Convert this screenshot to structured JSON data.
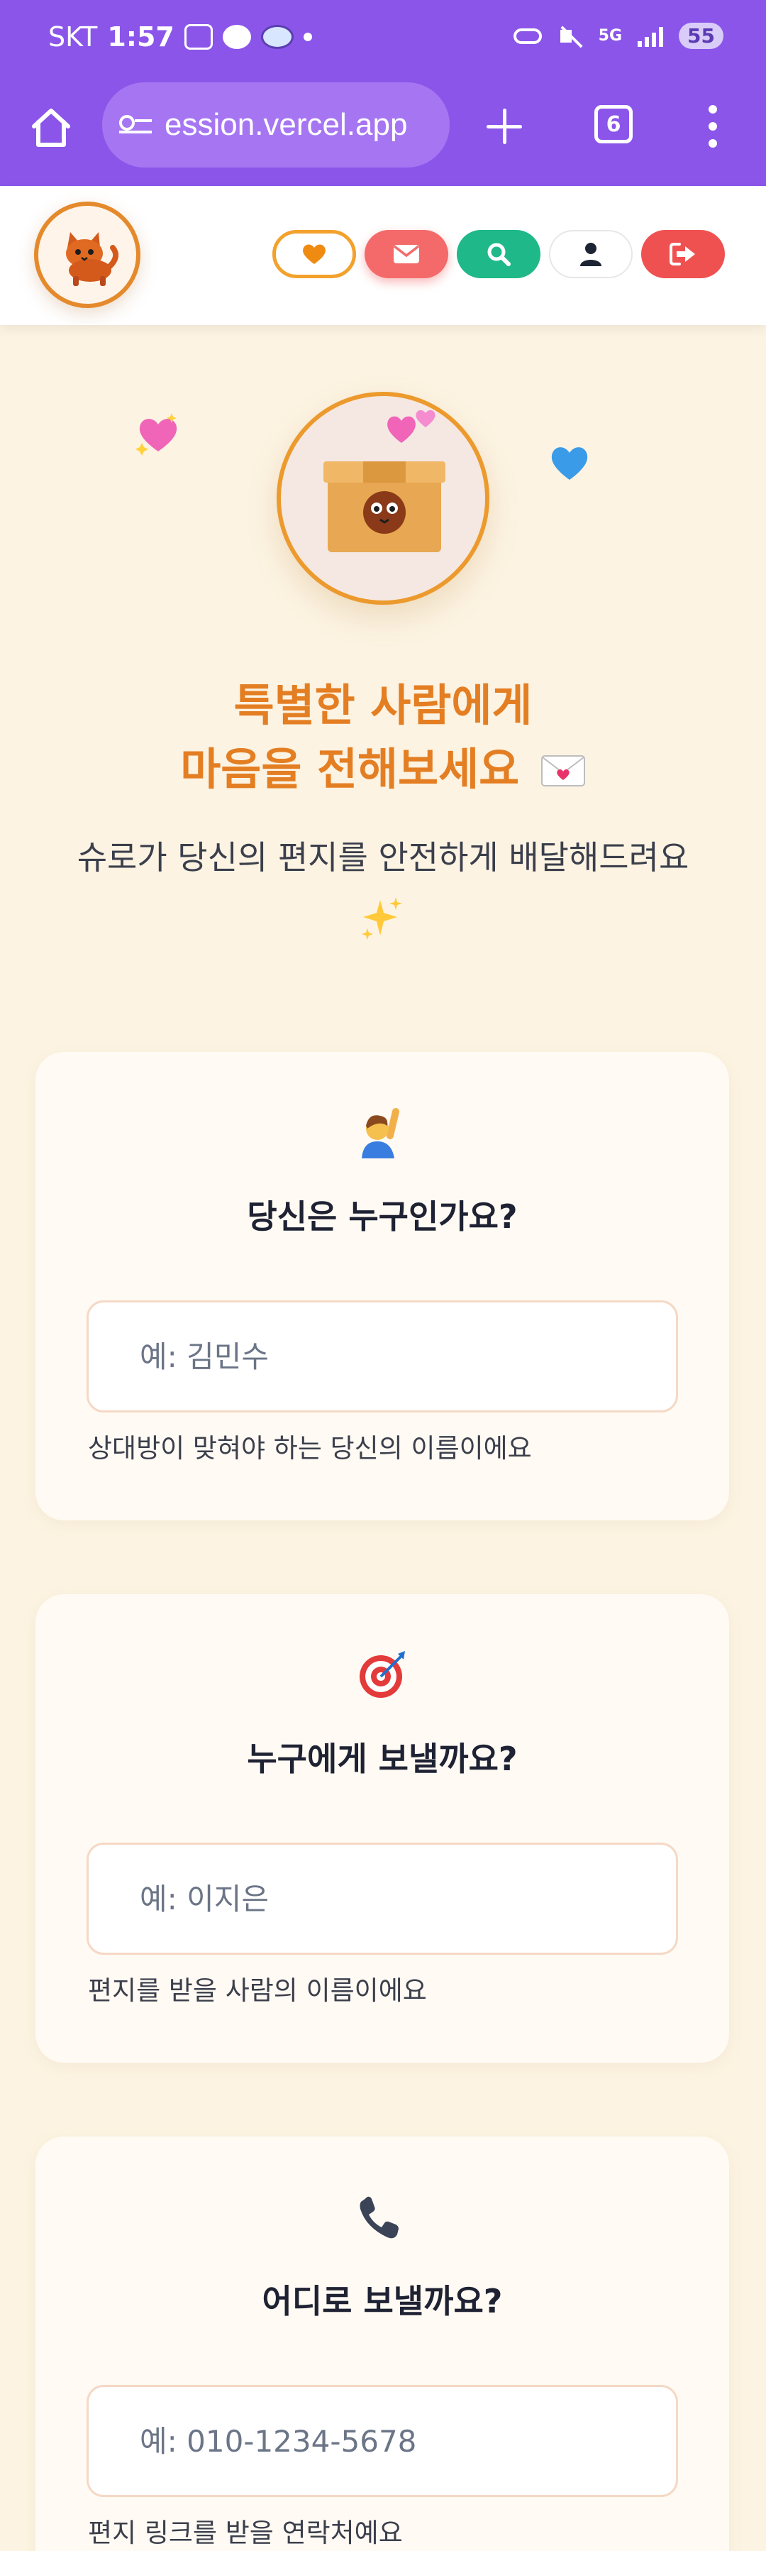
{
  "status_bar": {
    "carrier": "SKT",
    "time": "1:57",
    "network": "5G",
    "battery": "55"
  },
  "browser": {
    "url": "ession.vercel.app",
    "tab_count": "6"
  },
  "hero": {
    "title_line1": "특별한 사람에게",
    "title_line2": "마음을 전해보세요",
    "subtitle": "슈로가 당신의 편지를 안전하게 배달해드려요"
  },
  "form": {
    "sender": {
      "question": "당신은 누구인가요?",
      "placeholder": "예: 김민수",
      "hint": "상대방이 맞혀야 하는 당신의 이름이에요"
    },
    "recipient": {
      "question": "누구에게 보낼까요?",
      "placeholder": "예: 이지은",
      "hint": "편지를 받을 사람의 이름이에요"
    },
    "phone": {
      "question": "어디로 보낼까요?",
      "placeholder": "예: 010-1234-5678",
      "hint": "편지 링크를 받을 연락처예요"
    }
  },
  "colors": {
    "browser_purple": "#8b55ea",
    "accent_orange": "#e47e23",
    "page_bg": "#fcf3e2"
  }
}
